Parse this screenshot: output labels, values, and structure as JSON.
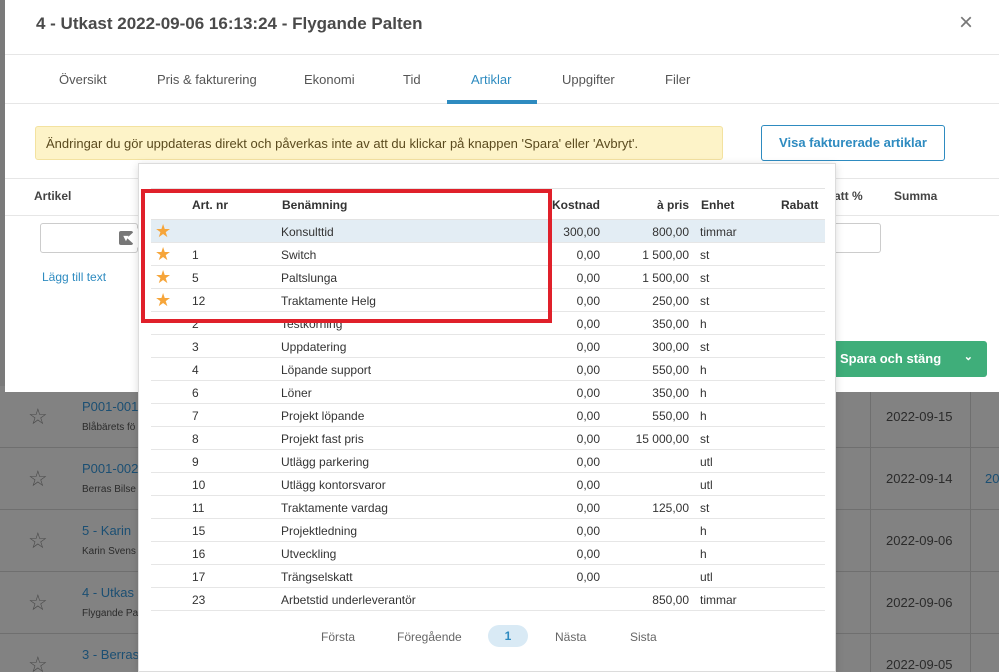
{
  "modal": {
    "title": "4 - Utkast 2022-09-06 16:13:24 - Flygande Palten",
    "close_glyph": "×"
  },
  "tabs": [
    {
      "label": "Översikt"
    },
    {
      "label": "Pris & fakturering"
    },
    {
      "label": "Ekonomi"
    },
    {
      "label": "Tid"
    },
    {
      "label": "Artiklar",
      "active": true
    },
    {
      "label": "Uppgifter"
    },
    {
      "label": "Filer"
    }
  ],
  "notice": "Ändringar du gör uppdateras direkt och påverkas inte av att du klickar på knappen 'Spara' eller 'Avbryt'.",
  "invoiced_button": "Visa fakturerade artiklar",
  "article_header": {
    "article": "Artikel",
    "discount_pct": "att %",
    "sum": "Summa"
  },
  "add_text_link": "Lägg till text",
  "save_close": {
    "label": "Spara och stäng",
    "caret": "⌄"
  },
  "popup": {
    "headers": {
      "art_nr": "Art. nr",
      "name": "Benämning",
      "cost": "Kostnad",
      "unit_price": "à pris",
      "unit": "Enhet",
      "discount": "Rabatt"
    },
    "rows": [
      {
        "star": true,
        "nr": "",
        "name": "Konsulttid",
        "cost": "300,00",
        "price": "800,00",
        "unit": "timmar",
        "highlight": true
      },
      {
        "star": true,
        "nr": "1",
        "name": "Switch",
        "cost": "0,00",
        "price": "1 500,00",
        "unit": "st"
      },
      {
        "star": true,
        "nr": "5",
        "name": "Paltslunga",
        "cost": "0,00",
        "price": "1 500,00",
        "unit": "st"
      },
      {
        "star": true,
        "nr": "12",
        "name": "Traktamente Helg",
        "cost": "0,00",
        "price": "250,00",
        "unit": "st"
      },
      {
        "star": false,
        "nr": "2",
        "name": "Testkörning",
        "cost": "0,00",
        "price": "350,00",
        "unit": "h"
      },
      {
        "star": false,
        "nr": "3",
        "name": "Uppdatering",
        "cost": "0,00",
        "price": "300,00",
        "unit": "st"
      },
      {
        "star": false,
        "nr": "4",
        "name": "Löpande support",
        "cost": "0,00",
        "price": "550,00",
        "unit": "h"
      },
      {
        "star": false,
        "nr": "6",
        "name": "Löner",
        "cost": "0,00",
        "price": "350,00",
        "unit": "h"
      },
      {
        "star": false,
        "nr": "7",
        "name": "Projekt löpande",
        "cost": "0,00",
        "price": "550,00",
        "unit": "h"
      },
      {
        "star": false,
        "nr": "8",
        "name": "Projekt fast pris",
        "cost": "0,00",
        "price": "15 000,00",
        "unit": "st"
      },
      {
        "star": false,
        "nr": "9",
        "name": "Utlägg parkering",
        "cost": "0,00",
        "price": "",
        "unit": "utl"
      },
      {
        "star": false,
        "nr": "10",
        "name": "Utlägg kontorsvaror",
        "cost": "0,00",
        "price": "",
        "unit": "utl"
      },
      {
        "star": false,
        "nr": "11",
        "name": "Traktamente vardag",
        "cost": "0,00",
        "price": "125,00",
        "unit": "st"
      },
      {
        "star": false,
        "nr": "15",
        "name": "Projektledning",
        "cost": "0,00",
        "price": "",
        "unit": "h"
      },
      {
        "star": false,
        "nr": "16",
        "name": "Utveckling",
        "cost": "0,00",
        "price": "",
        "unit": "h"
      },
      {
        "star": false,
        "nr": "17",
        "name": "Trängselskatt",
        "cost": "0,00",
        "price": "",
        "unit": "utl"
      },
      {
        "star": false,
        "nr": "23",
        "name": "Arbetstid underleverantör",
        "cost": "",
        "price": "850,00",
        "unit": "timmar"
      }
    ],
    "pager": {
      "first": "Första",
      "prev": "Föregående",
      "current": "1",
      "next": "Nästa",
      "last": "Sista"
    }
  },
  "background_rows": [
    {
      "title": "P001-001",
      "sub": "Blåbärets fö",
      "date": "2022-09-15",
      "extra": ""
    },
    {
      "title": "P001-002",
      "sub": "Berras Bilse",
      "date": "2022-09-14",
      "extra": "20"
    },
    {
      "title": "5 - Karin",
      "sub": "Karin Svens",
      "date": "2022-09-06",
      "extra": ""
    },
    {
      "title": "4 - Utkas",
      "sub": "Flygande Pa",
      "date": "2022-09-06",
      "extra": ""
    },
    {
      "title": "3 - Berras",
      "sub": "",
      "date": "2022-09-05",
      "extra": ""
    }
  ],
  "colors": {
    "accent": "#2e8bc0",
    "star": "#f6a53a",
    "save": "#3fae7a",
    "highlight_box": "#e0202a",
    "notice_bg": "#fdf3c8"
  }
}
